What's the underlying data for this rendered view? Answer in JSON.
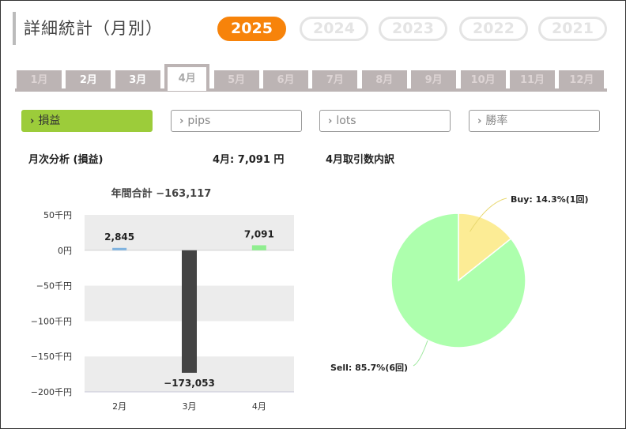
{
  "header": {
    "title": "詳細統計（月別）"
  },
  "years": [
    {
      "label": "2025",
      "active": true
    },
    {
      "label": "2024",
      "active": false
    },
    {
      "label": "2023",
      "active": false
    },
    {
      "label": "2022",
      "active": false
    },
    {
      "label": "2021",
      "active": false
    }
  ],
  "months": [
    {
      "label": "1月",
      "state": "dim"
    },
    {
      "label": "2月",
      "state": "normal"
    },
    {
      "label": "3月",
      "state": "normal"
    },
    {
      "label": "4月",
      "state": "active"
    },
    {
      "label": "5月",
      "state": "dim"
    },
    {
      "label": "6月",
      "state": "dim"
    },
    {
      "label": "7月",
      "state": "dim"
    },
    {
      "label": "8月",
      "state": "dim"
    },
    {
      "label": "9月",
      "state": "dim"
    },
    {
      "label": "10月",
      "state": "dim"
    },
    {
      "label": "11月",
      "state": "dim"
    },
    {
      "label": "12月",
      "state": "dim"
    }
  ],
  "metrics": [
    {
      "label": "損益",
      "active": true
    },
    {
      "label": "pips",
      "active": false
    },
    {
      "label": "lots",
      "active": false
    },
    {
      "label": "勝率",
      "active": false
    }
  ],
  "summary": {
    "analysis_title": "月次分析 (損益)",
    "month_value": "4月:  7,091 円",
    "breakdown_title": "4月取引数内訳"
  },
  "colors": {
    "accent": "#f7830a",
    "metric_active": "#9ccc3a",
    "tab": "#bcb4b4",
    "bar_negative": "#444444",
    "bar_feb": "#7fb3e0",
    "bar_apr": "#90ee90",
    "pie_buy": "#fcec95",
    "pie_sell": "#adffad"
  },
  "chart_data": [
    {
      "type": "bar",
      "title": "年間合計 −163,117",
      "categories": [
        "2月",
        "3月",
        "4月"
      ],
      "values": [
        2845,
        -173053,
        7091
      ],
      "value_labels": [
        "2,845",
        "−173,053",
        "7,091"
      ],
      "ylim": [
        -200000,
        50000
      ],
      "yticks": [
        50000,
        0,
        -50000,
        -100000,
        -150000,
        -200000
      ],
      "ytick_labels": [
        "50千円",
        "0円",
        "−50千円",
        "−100千円",
        "−150千円",
        "−200千円"
      ],
      "grid": "alternating bands"
    },
    {
      "type": "pie",
      "slices": [
        {
          "label": "Buy: 14.3%(1回)",
          "value": 14.3
        },
        {
          "label": "Sell: 85.7%(6回)",
          "value": 85.7
        }
      ]
    }
  ]
}
